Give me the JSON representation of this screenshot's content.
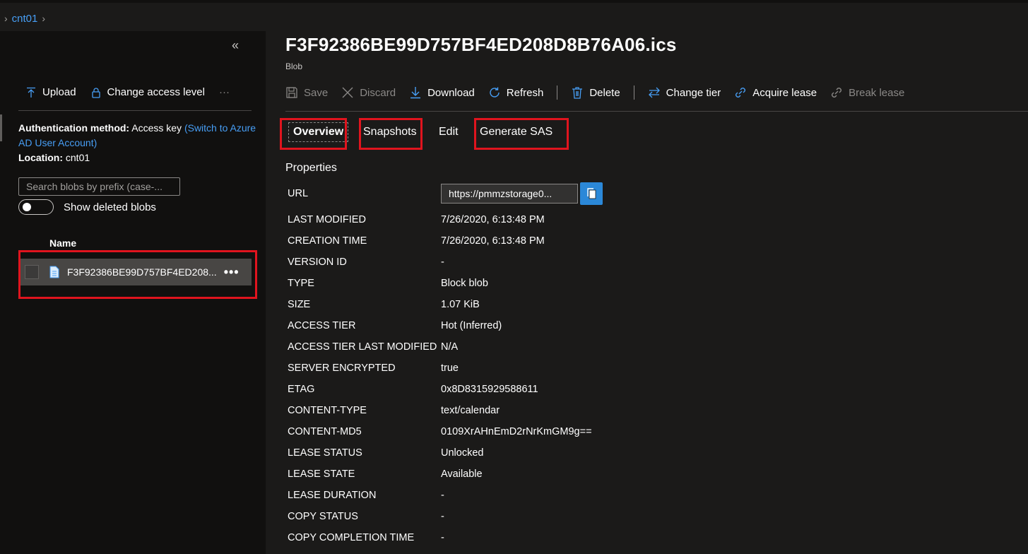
{
  "breadcrumb": {
    "container": "cnt01"
  },
  "left": {
    "collapse_glyph": "«",
    "toolbar": {
      "upload": "Upload",
      "change_access": "Change access level",
      "more": "···"
    },
    "auth": {
      "label": "Authentication method:",
      "value": "Access key",
      "switch_link": "(Switch to Azure AD User Account)",
      "location_label": "Location:",
      "location_value": "cnt01"
    },
    "search_placeholder": "Search blobs by prefix (case-...",
    "show_deleted": "Show deleted blobs",
    "column_name": "Name",
    "blob": {
      "name": "F3F92386BE99D757BF4ED208...",
      "more": "•••"
    }
  },
  "main": {
    "title": "F3F92386BE99D757BF4ED208D8B76A06.ics",
    "subtitle": "Blob",
    "toolbar": {
      "save": "Save",
      "discard": "Discard",
      "download": "Download",
      "refresh": "Refresh",
      "delete": "Delete",
      "change_tier": "Change tier",
      "acquire_lease": "Acquire lease",
      "break_lease": "Break lease"
    },
    "tabs": {
      "overview": "Overview",
      "snapshots": "Snapshots",
      "edit": "Edit",
      "generate_sas": "Generate SAS"
    },
    "properties_heading": "Properties",
    "url": {
      "label": "URL",
      "value": "https://pmmzstorage0..."
    },
    "properties": [
      {
        "key": "LAST MODIFIED",
        "value": "7/26/2020, 6:13:48 PM"
      },
      {
        "key": "CREATION TIME",
        "value": "7/26/2020, 6:13:48 PM"
      },
      {
        "key": "VERSION ID",
        "value": "-"
      },
      {
        "key": "TYPE",
        "value": "Block blob"
      },
      {
        "key": "SIZE",
        "value": "1.07 KiB"
      },
      {
        "key": "ACCESS TIER",
        "value": "Hot (Inferred)"
      },
      {
        "key": "ACCESS TIER LAST MODIFIED",
        "value": "N/A"
      },
      {
        "key": "SERVER ENCRYPTED",
        "value": "true"
      },
      {
        "key": "ETAG",
        "value": "0x8D8315929588611"
      },
      {
        "key": "CONTENT-TYPE",
        "value": "text/calendar"
      },
      {
        "key": "CONTENT-MD5",
        "value": "0109XrAHnEmD2rNrKmGM9g=="
      },
      {
        "key": "LEASE STATUS",
        "value": "Unlocked"
      },
      {
        "key": "LEASE STATE",
        "value": "Available"
      },
      {
        "key": "LEASE DURATION",
        "value": "-"
      },
      {
        "key": "COPY STATUS",
        "value": "-"
      },
      {
        "key": "COPY COMPLETION TIME",
        "value": "-"
      }
    ]
  },
  "colors": {
    "accent": "#479ef5",
    "highlight_box": "#e0141e",
    "copy_button": "#2b88d8"
  }
}
